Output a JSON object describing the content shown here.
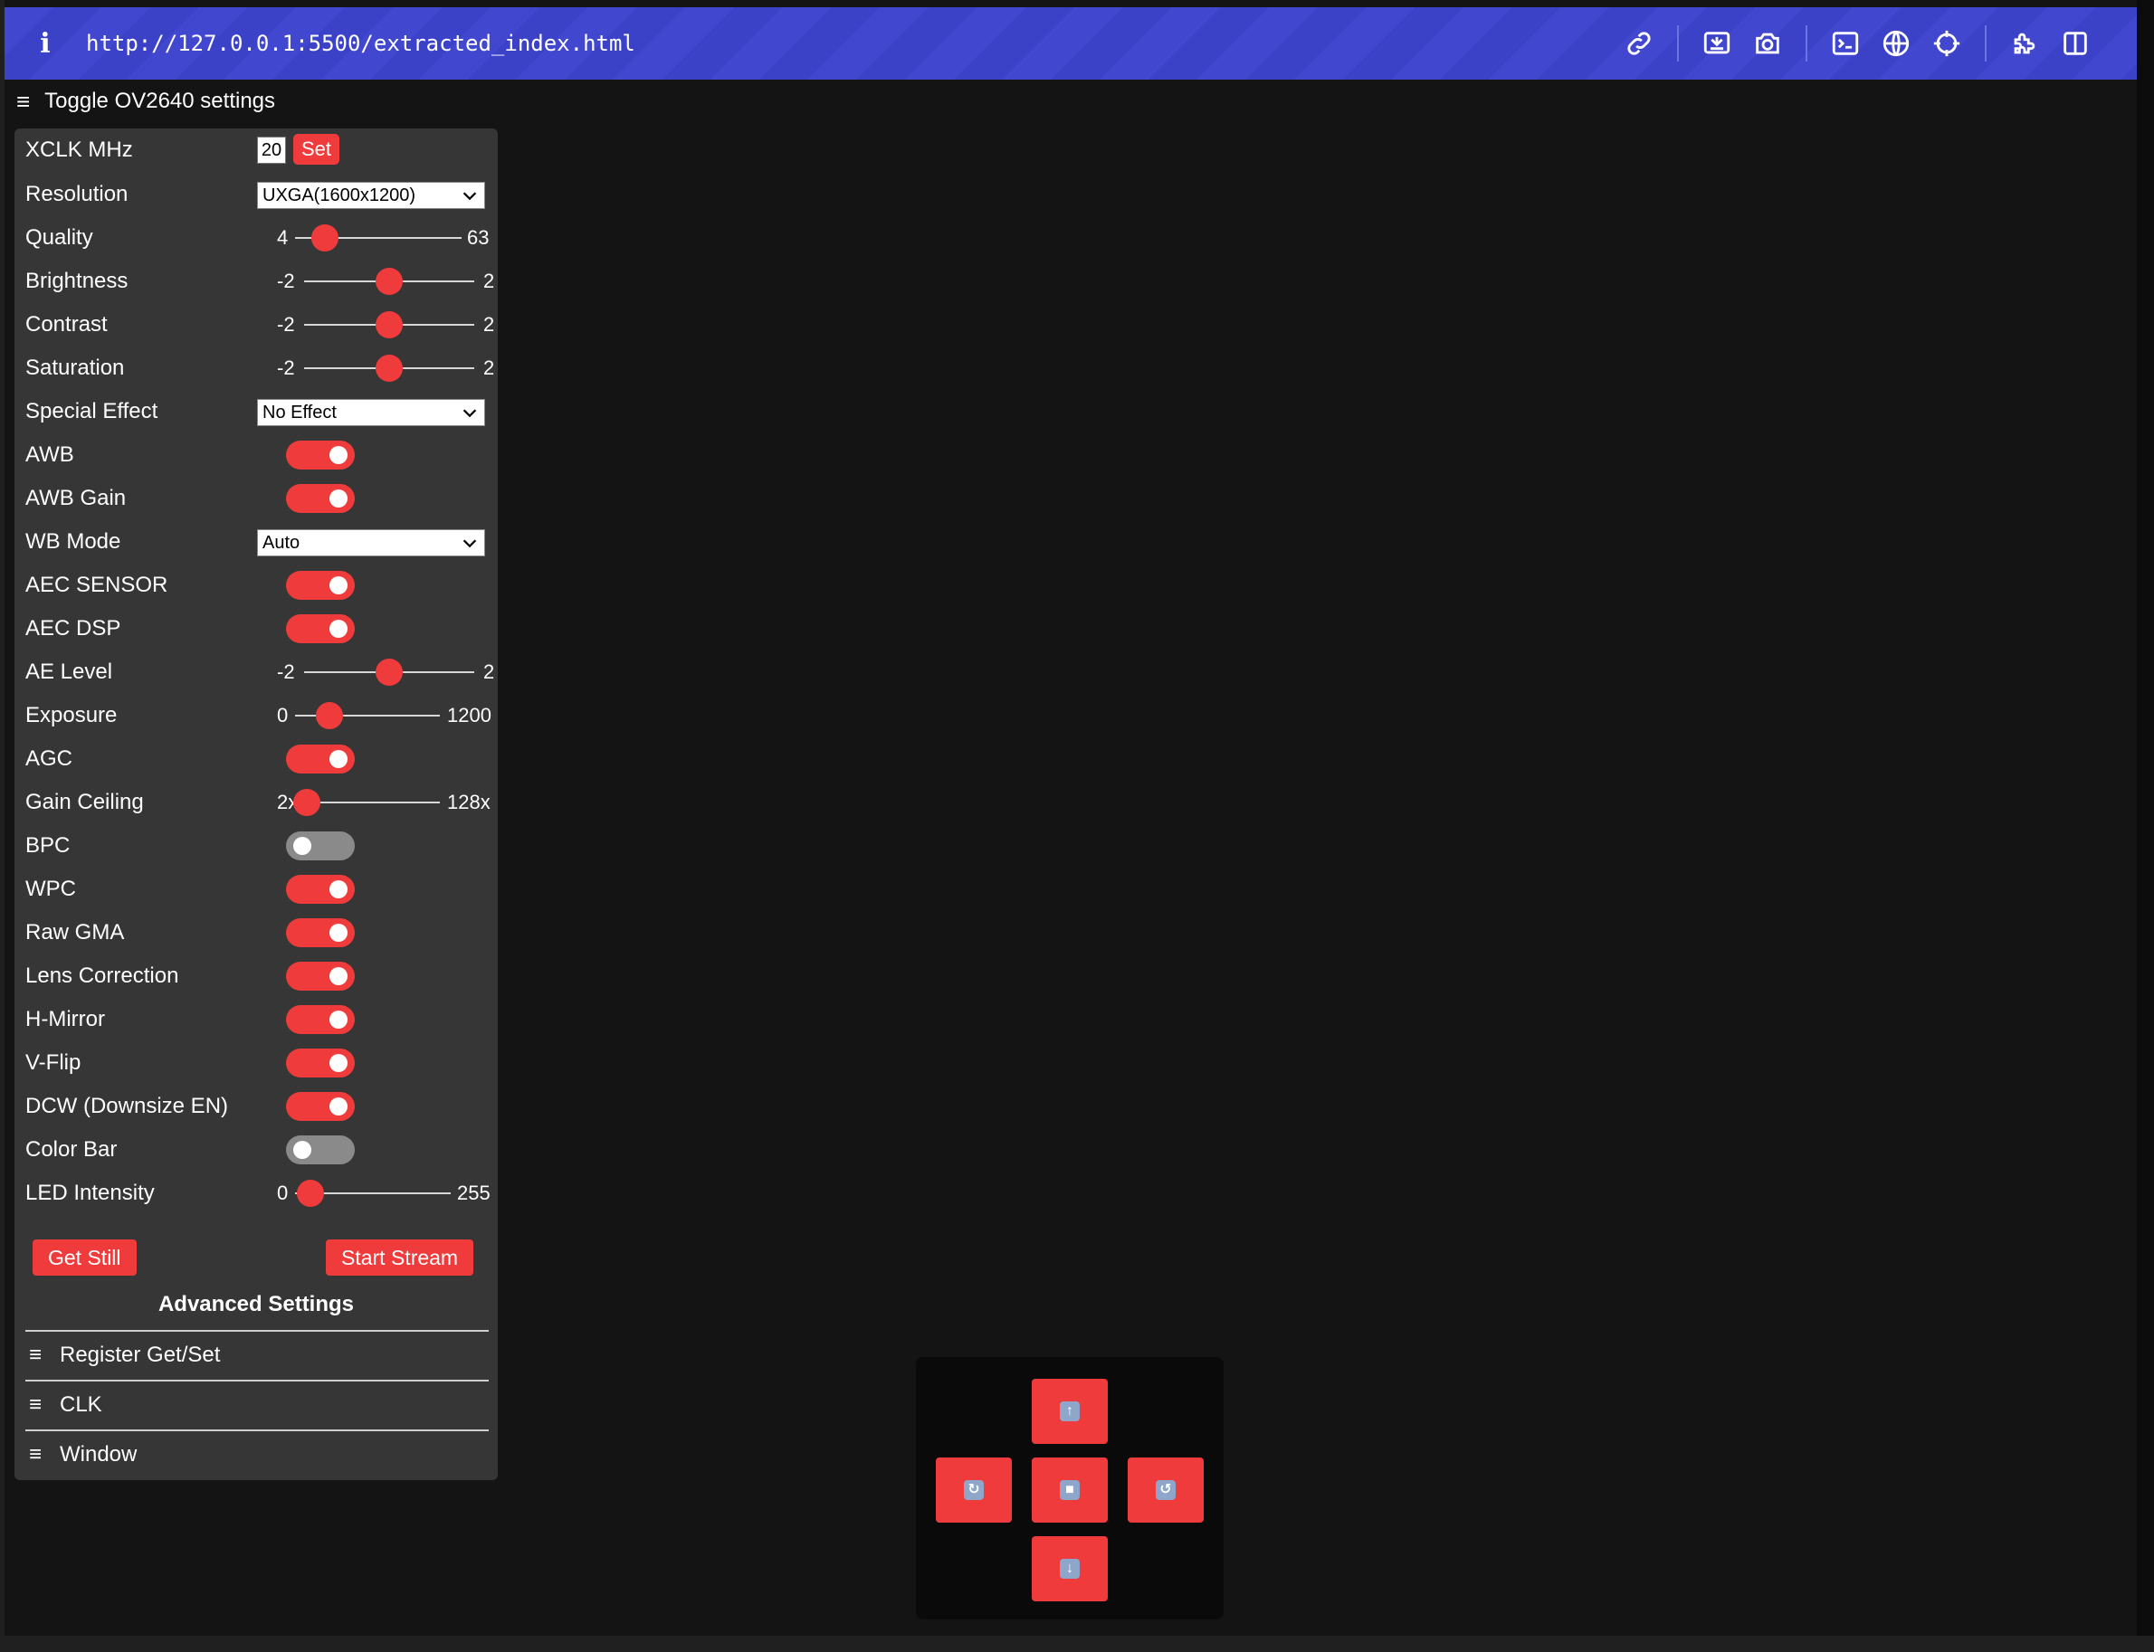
{
  "browser": {
    "info_glyph": "i",
    "url": "http://127.0.0.1:5500/extracted_index.html",
    "icons": [
      "link-icon",
      "screenshot-icon",
      "camera-icon",
      "terminal-icon",
      "globe-icon",
      "crosshair-icon",
      "extensions-icon",
      "sidebar-icon"
    ]
  },
  "toggle_label": "Toggle OV2640 settings",
  "settings": {
    "xclk": {
      "label": "XCLK MHz",
      "value": "20",
      "button": "Set"
    },
    "resolution": {
      "label": "Resolution",
      "value": "UXGA(1600x1200)"
    },
    "quality": {
      "label": "Quality",
      "min": "4",
      "max": "63",
      "value": 10
    },
    "brightness": {
      "label": "Brightness",
      "min": "-2",
      "max": "2",
      "value": 0
    },
    "contrast": {
      "label": "Contrast",
      "min": "-2",
      "max": "2",
      "value": 0
    },
    "saturation": {
      "label": "Saturation",
      "min": "-2",
      "max": "2",
      "value": 0
    },
    "special_effect": {
      "label": "Special Effect",
      "value": "No Effect"
    },
    "awb": {
      "label": "AWB",
      "on": true
    },
    "awb_gain": {
      "label": "AWB Gain",
      "on": true
    },
    "wb_mode": {
      "label": "WB Mode",
      "value": "Auto"
    },
    "aec_sensor": {
      "label": "AEC SENSOR",
      "on": true
    },
    "aec_dsp": {
      "label": "AEC DSP",
      "on": true
    },
    "ae_level": {
      "label": "AE Level",
      "min": "-2",
      "max": "2",
      "value": 0
    },
    "exposure": {
      "label": "Exposure",
      "min": "0",
      "max": "1200",
      "value": 204
    },
    "agc": {
      "label": "AGC",
      "on": true
    },
    "gain_ceiling": {
      "label": "Gain Ceiling",
      "min": "2x",
      "max": "128x",
      "value": 0
    },
    "bpc": {
      "label": "BPC",
      "on": false
    },
    "wpc": {
      "label": "WPC",
      "on": true
    },
    "raw_gma": {
      "label": "Raw GMA",
      "on": true
    },
    "lens_correction": {
      "label": "Lens Correction",
      "on": true
    },
    "h_mirror": {
      "label": "H-Mirror",
      "on": true
    },
    "v_flip": {
      "label": "V-Flip",
      "on": true
    },
    "dcw": {
      "label": "DCW (Downsize EN)",
      "on": true
    },
    "color_bar": {
      "label": "Color Bar",
      "on": false
    },
    "led_intensity": {
      "label": "LED Intensity",
      "min": "0",
      "max": "255",
      "value": 0
    }
  },
  "buttons": {
    "get_still": "Get Still",
    "start_stream": "Start Stream"
  },
  "advanced": {
    "title": "Advanced Settings",
    "items": [
      "Register Get/Set",
      "CLK",
      "Window"
    ]
  },
  "pad": {
    "up": "up-arrow-icon",
    "down": "down-arrow-icon",
    "left": "rotate-left-icon",
    "right": "rotate-right-icon",
    "stop": "stop-icon"
  },
  "colors": {
    "accent": "#ef3b3b",
    "browser_bar": "#4147cf",
    "panel": "#363636",
    "page_bg": "#141414"
  }
}
